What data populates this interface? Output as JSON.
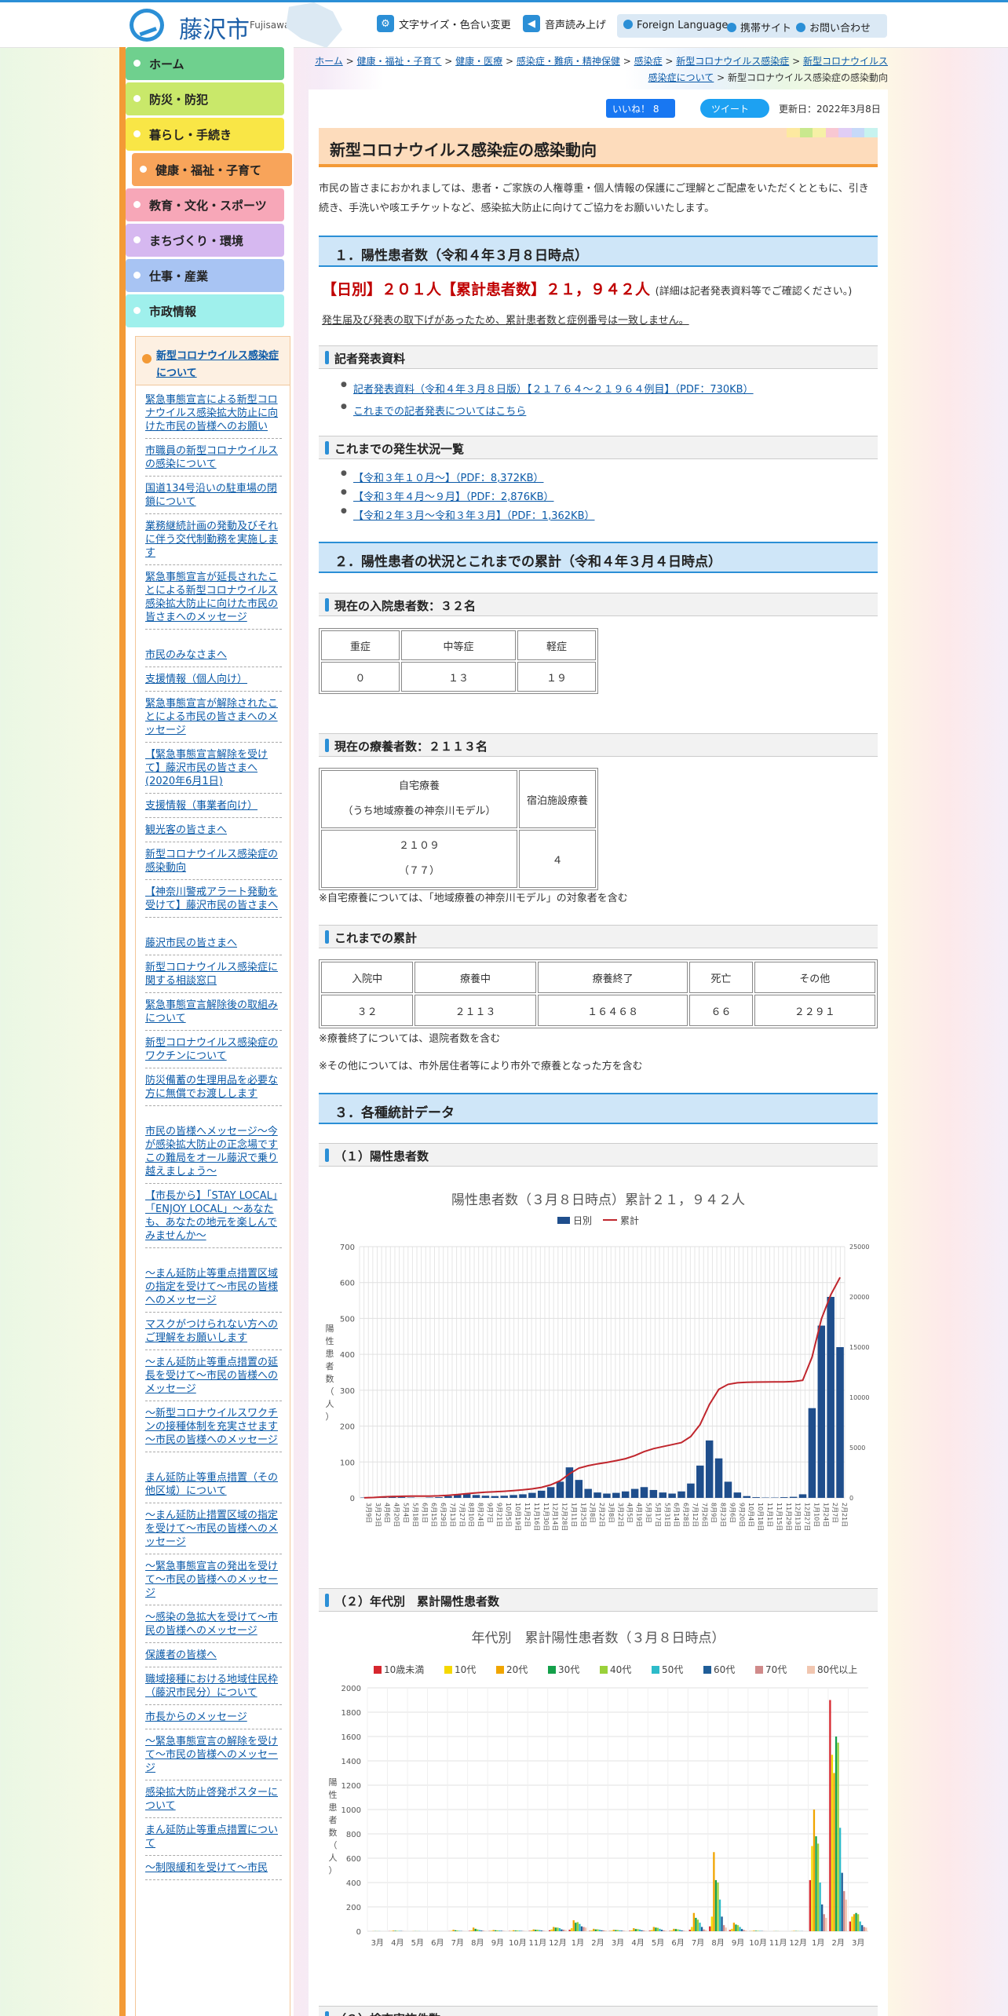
{
  "header": {
    "site_name": "藤沢市",
    "site_name_en": "Fujisawa City",
    "font_color_link": "文字サイズ・色合い変更",
    "voice_link": "音声読み上げ",
    "foreign_language": "Foreign Language",
    "mobile_site": "携帯サイト",
    "contact": "お問い合わせ"
  },
  "global_nav": [
    {
      "label": "ホーム",
      "color": "#6fd08e"
    },
    {
      "label": "防災・防犯",
      "color": "#c9e86a"
    },
    {
      "label": "暮らし・手続き",
      "color": "#f9e646"
    },
    {
      "label": "健康・福祉・子育て",
      "color": "#f8a45a"
    },
    {
      "label": "教育・文化・スポーツ",
      "color": "#f7a7b8"
    },
    {
      "label": "まちづくり・環境",
      "color": "#d6b8f0"
    },
    {
      "label": "仕事・産業",
      "color": "#a8c4f3"
    },
    {
      "label": "市政情報",
      "color": "#9ff0ec"
    }
  ],
  "subnav": {
    "heading": "新型コロナウイルス感染症について",
    "items": [
      "緊急事態宣言による新型コロナウイルス感染拡大防止に向けた市民の皆様へのお願い",
      "市職員の新型コロナウイルスの感染について",
      "国道134号沿いの駐車場の閉鎖について",
      "業務継続計画の発動及びそれに伴う交代制勤務を実施します",
      "緊急事態宣言が延長されたことによる新型コロナウイルス感染拡大防止に向けた市民の皆さまへのメッセージ",
      "市民のみなさまへ",
      "支援情報（個人向け）",
      "緊急事態宣言が解除されたことによる市民の皆さまへのメッセージ",
      "【緊急事態宣言解除を受けて】藤沢市民の皆さまへ(2020年6月1日)",
      "支援情報（事業者向け）",
      "観光客の皆さまへ",
      "新型コロナウイルス感染症の感染動向",
      "【神奈川警戒アラート発動を受けて】藤沢市民の皆さまへ",
      "藤沢市民の皆さまへ",
      "新型コロナウイルス感染症に関する相談窓口",
      "緊急事態宣言解除後の取組みについて",
      "新型コロナウイルス感染症のワクチンについて",
      "防災備蓄の生理用品を必要な方に無償でお渡しします",
      "市民の皆様へメッセージ～今が感染拡大防止の正念場です この難局をオール藤沢で乗り越えましょう～",
      "【市長から】「STAY LOCAL」「ENJOY LOCAL」～あなたも、あなたの地元を楽しんでみませんか～",
      "～まん延防止等重点措置区域の指定を受けて～市民の皆様へのメッセージ",
      "マスクがつけられない方へのご理解をお願いします",
      "～まん延防止等重点措置の延長を受けて～市民の皆様へのメッセージ",
      "～新型コロナウイルスワクチンの接種体制を充実させます～市民の皆様へのメッセージ",
      "まん延防止等重点措置（その他区域）について",
      "～まん延防止措置区域の指定を受けて～市民の皆様へのメッセージ",
      "～緊急事態宣言の発出を受けて～市民の皆様へのメッセージ",
      "～感染の急拡大を受けて～市民の皆様へのメッセージ",
      "保護者の皆様へ",
      "職域接種における地域住民枠（藤沢市民分）について",
      "市長からのメッセージ",
      "～緊急事態宣言の解除を受けて～市民の皆様へのメッセージ",
      "感染拡大防止啓発ポスターについて",
      "まん延防止等重点措置について",
      "～制限緩和を受けて～市民"
    ]
  },
  "breadcrumb": {
    "items": [
      "ホーム",
      "健康・福祉・子育て",
      "健康・医療",
      "感染症・難病・精神保健",
      "感染症",
      "新型コロナウイルス感染症",
      "新型コロナウイルス感染症について"
    ],
    "current": "新型コロナウイルス感染症の感染動向"
  },
  "social": {
    "like": "いいね！ 8",
    "tweet": "ツイート",
    "updated": "更新日：2022年3月8日"
  },
  "page": {
    "title": "新型コロナウイルス感染症の感染動向",
    "intro": "市民の皆さまにおかれましては、患者・ご家族の人権尊重・個人情報の保護にご理解とご配慮をいただくとともに、引き続き、手洗いや咳エチケットなど、感染拡大防止に向けてご協力をお願いいたします。"
  },
  "section1": {
    "title": "１．陽性患者数（令和４年３月８日時点）",
    "daily_total": "【日別】２０１人【累計患者数】２１，９４２人",
    "daily_note": "(詳細は記者発表資料等でご確認ください。)",
    "mismatch_note": "発生届及び発表の取下げがあったため、累計患者数と症例番号は一致しません。",
    "press_title": "記者発表資料",
    "press_links": [
      "記者発表資料（令和４年３月８日版）【２１７６４～２１９６４例目】（PDF：730KB）",
      "これまでの記者発表についてはこちら"
    ],
    "history_title": "これまでの発生状況一覧",
    "history_links": [
      "【令和３年１０月～】（PDF：8,372KB）",
      "【令和３年４月～９月】（PDF：2,876KB）",
      "【令和２年３月～令和３年３月】（PDF：1,362KB）"
    ]
  },
  "section2": {
    "title": "２．陽性患者の状況とこれまでの累計（令和４年３月４日時点）",
    "hospital_title": "現在の入院患者数：３２名",
    "hospital_headers": [
      "重症",
      "中等症",
      "軽症"
    ],
    "hospital_values": [
      "０",
      "１３",
      "１９"
    ],
    "home_title": "現在の療養者数：２１１３名",
    "home_header1": "自宅療養",
    "home_header1_sub": "（うち地域療養の神奈川モデル）",
    "home_header2": "宿泊施設療養",
    "home_value1": "２１０９",
    "home_value1_sub": "（７７）",
    "home_value2": "４",
    "home_note": "※自宅療養については、「地域療養の神奈川モデル」の対象者を含む",
    "cumulative_title": "これまでの累計",
    "cumulative_headers": [
      "入院中",
      "療養中",
      "療養終了",
      "死亡",
      "その他"
    ],
    "cumulative_values": [
      "３２",
      "２１１３",
      "１６４６８",
      "６６",
      "２２９１"
    ],
    "note1": "※療養終了については、退院者数を含む",
    "note2": "※その他については、市外居住者等により市外で療養となった方を含む"
  },
  "section3": {
    "title": "３．各種統計データ",
    "sub1": "（１）陽性患者数",
    "sub2": "（２）年代別　累計陽性患者数",
    "sub3_partial": "（３）検査実施件数"
  },
  "chart_data": [
    {
      "type": "bar",
      "title": "陽性患者数（３月８日時点）累計２１，９４２人",
      "ylabel": "陽性患者数（人）",
      "ylim": [
        0,
        700
      ],
      "y2lim": [
        0,
        25000
      ],
      "yticks": [
        "0",
        "100",
        "200",
        "300",
        "400",
        "500",
        "600",
        "700"
      ],
      "y2ticks": [
        "0",
        "5000",
        "10000",
        "15000",
        "20000",
        "25000"
      ],
      "legend": [
        "日別",
        "累計"
      ],
      "legend_position": "top",
      "series_colors": {
        "daily": "#1f4e8c",
        "cumulative": "#c0262d"
      },
      "categories": [
        "3月9日",
        "3月23日",
        "4月6日",
        "4月20日",
        "5月4日",
        "5月18日",
        "6月1日",
        "6月15日",
        "6月29日",
        "7月13日",
        "7月27日",
        "8月10日",
        "8月24日",
        "9月7日",
        "9月21日",
        "10月5日",
        "10月19日",
        "11月2日",
        "11月16日",
        "11月30日",
        "12月14日",
        "12月28日",
        "1月11日",
        "1月25日",
        "2月8日",
        "2月22日",
        "3月8日",
        "3月22日",
        "4月5日",
        "4月19日",
        "5月3日",
        "5月17日",
        "5月31日",
        "6月14日",
        "6月28日",
        "7月12日",
        "7月26日",
        "8月9日",
        "8月23日",
        "9月6日",
        "9月20日",
        "10月4日",
        "10月18日",
        "11月1日",
        "11月15日",
        "11月29日",
        "12月13日",
        "12月27日",
        "1月10日",
        "1月24日",
        "2月7日",
        "2月21日"
      ],
      "series": [
        {
          "name": "日別",
          "values": [
            1,
            2,
            3,
            4,
            2,
            1,
            0,
            1,
            2,
            5,
            10,
            12,
            8,
            6,
            5,
            6,
            8,
            10,
            14,
            20,
            30,
            45,
            85,
            50,
            25,
            15,
            12,
            14,
            18,
            25,
            30,
            22,
            15,
            12,
            18,
            40,
            90,
            160,
            110,
            45,
            15,
            5,
            2,
            1,
            1,
            2,
            3,
            10,
            250,
            480,
            560,
            420
          ]
        },
        {
          "name": "累計",
          "values": [
            10,
            40,
            90,
            130,
            160,
            170,
            175,
            180,
            200,
            260,
            330,
            420,
            500,
            560,
            610,
            660,
            720,
            800,
            900,
            1050,
            1300,
            1700,
            2400,
            2950,
            3200,
            3380,
            3520,
            3700,
            3900,
            4200,
            4600,
            4900,
            5100,
            5300,
            5500,
            6100,
            7300,
            9300,
            10800,
            11300,
            11450,
            11500,
            11520,
            11530,
            11540,
            11550,
            11580,
            11700,
            14000,
            17800,
            20200,
            21942
          ]
        }
      ]
    },
    {
      "type": "bar",
      "title": "年代別　累計陽性患者数（３月８日時点）",
      "ylabel": "陽性患者数（人）",
      "ylim": [
        0,
        2000
      ],
      "yticks": [
        "0",
        "200",
        "400",
        "600",
        "800",
        "1000",
        "1200",
        "1400",
        "1600",
        "1800",
        "2000"
      ],
      "legend_position": "top",
      "categories": [
        "3月",
        "4月",
        "5月",
        "6月",
        "7月",
        "8月",
        "9月",
        "10月",
        "11月",
        "12月",
        "1月",
        "2月",
        "3月",
        "4月",
        "5月",
        "6月",
        "7月",
        "8月",
        "9月",
        "10月",
        "11月",
        "12月",
        "1月",
        "2月",
        "3月"
      ],
      "series": [
        {
          "name": "10歳未満",
          "color": "#d6262e",
          "values": [
            0,
            1,
            0,
            0,
            1,
            3,
            2,
            2,
            3,
            8,
            12,
            3,
            2,
            4,
            5,
            3,
            12,
            40,
            10,
            1,
            0,
            0,
            420,
            1900,
            80
          ]
        },
        {
          "name": "10代",
          "color": "#f5d800",
          "values": [
            0,
            2,
            0,
            0,
            3,
            8,
            4,
            3,
            6,
            15,
            25,
            6,
            4,
            8,
            10,
            6,
            35,
            120,
            20,
            2,
            0,
            1,
            700,
            1450,
            120
          ]
        },
        {
          "name": "20代",
          "color": "#f0a500",
          "values": [
            1,
            5,
            1,
            0,
            12,
            30,
            10,
            8,
            15,
            35,
            90,
            20,
            12,
            25,
            35,
            20,
            150,
            650,
            70,
            5,
            1,
            3,
            1000,
            1300,
            140
          ]
        },
        {
          "name": "30代",
          "color": "#14a04a",
          "values": [
            1,
            4,
            1,
            0,
            8,
            20,
            8,
            6,
            12,
            30,
            70,
            15,
            10,
            18,
            30,
            18,
            110,
            420,
            55,
            4,
            1,
            2,
            780,
            1600,
            150
          ]
        },
        {
          "name": "40代",
          "color": "#9ad13a",
          "values": [
            1,
            3,
            1,
            0,
            6,
            15,
            7,
            6,
            12,
            30,
            75,
            16,
            10,
            18,
            28,
            16,
            95,
            400,
            50,
            4,
            1,
            2,
            720,
            1550,
            140
          ]
        },
        {
          "name": "50代",
          "color": "#2dbbc9",
          "values": [
            1,
            3,
            1,
            0,
            4,
            10,
            6,
            5,
            10,
            25,
            60,
            12,
            8,
            14,
            20,
            12,
            70,
            260,
            35,
            3,
            0,
            1,
            400,
            850,
            80
          ]
        },
        {
          "name": "60代",
          "color": "#1f5d98",
          "values": [
            0,
            2,
            0,
            0,
            2,
            6,
            4,
            3,
            6,
            15,
            40,
            8,
            5,
            8,
            12,
            7,
            35,
            120,
            18,
            2,
            0,
            1,
            220,
            480,
            50
          ]
        },
        {
          "name": "70代",
          "color": "#d08a8a",
          "values": [
            0,
            1,
            0,
            0,
            1,
            4,
            3,
            2,
            4,
            12,
            35,
            7,
            4,
            6,
            7,
            4,
            15,
            50,
            10,
            1,
            0,
            0,
            140,
            330,
            35
          ]
        },
        {
          "name": "80代以上",
          "color": "#f1c6b0",
          "values": [
            0,
            1,
            0,
            0,
            1,
            3,
            2,
            2,
            3,
            10,
            30,
            6,
            3,
            4,
            5,
            3,
            10,
            30,
            6,
            1,
            0,
            0,
            110,
            260,
            30
          ]
        }
      ]
    }
  ]
}
